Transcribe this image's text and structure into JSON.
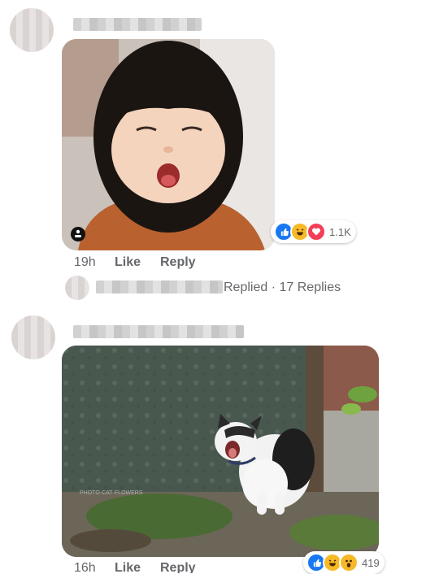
{
  "comments": [
    {
      "time": "19h",
      "like_label": "Like",
      "reply_label": "Reply",
      "reactions": {
        "icons": [
          "like-icon",
          "haha-icon",
          "love-icon"
        ],
        "count": "1.1K"
      },
      "photo_subject": "girl-yawning-photo"
    },
    {
      "time": "16h",
      "like_label": "Like",
      "reply_label": "Reply",
      "reactions": {
        "icons": [
          "like-icon",
          "haha-icon",
          "wow-icon"
        ],
        "count": "419"
      },
      "photo_subject": "cat-yawning-photo"
    }
  ],
  "reply_summary": {
    "replied": "Replied",
    "separator": "·",
    "count_text": "17 Replies"
  },
  "colors": {
    "like": "#1877f2",
    "haha": "#f7b928",
    "love": "#f33e58",
    "wow": "#f7b928",
    "meta_text": "#65676b"
  }
}
